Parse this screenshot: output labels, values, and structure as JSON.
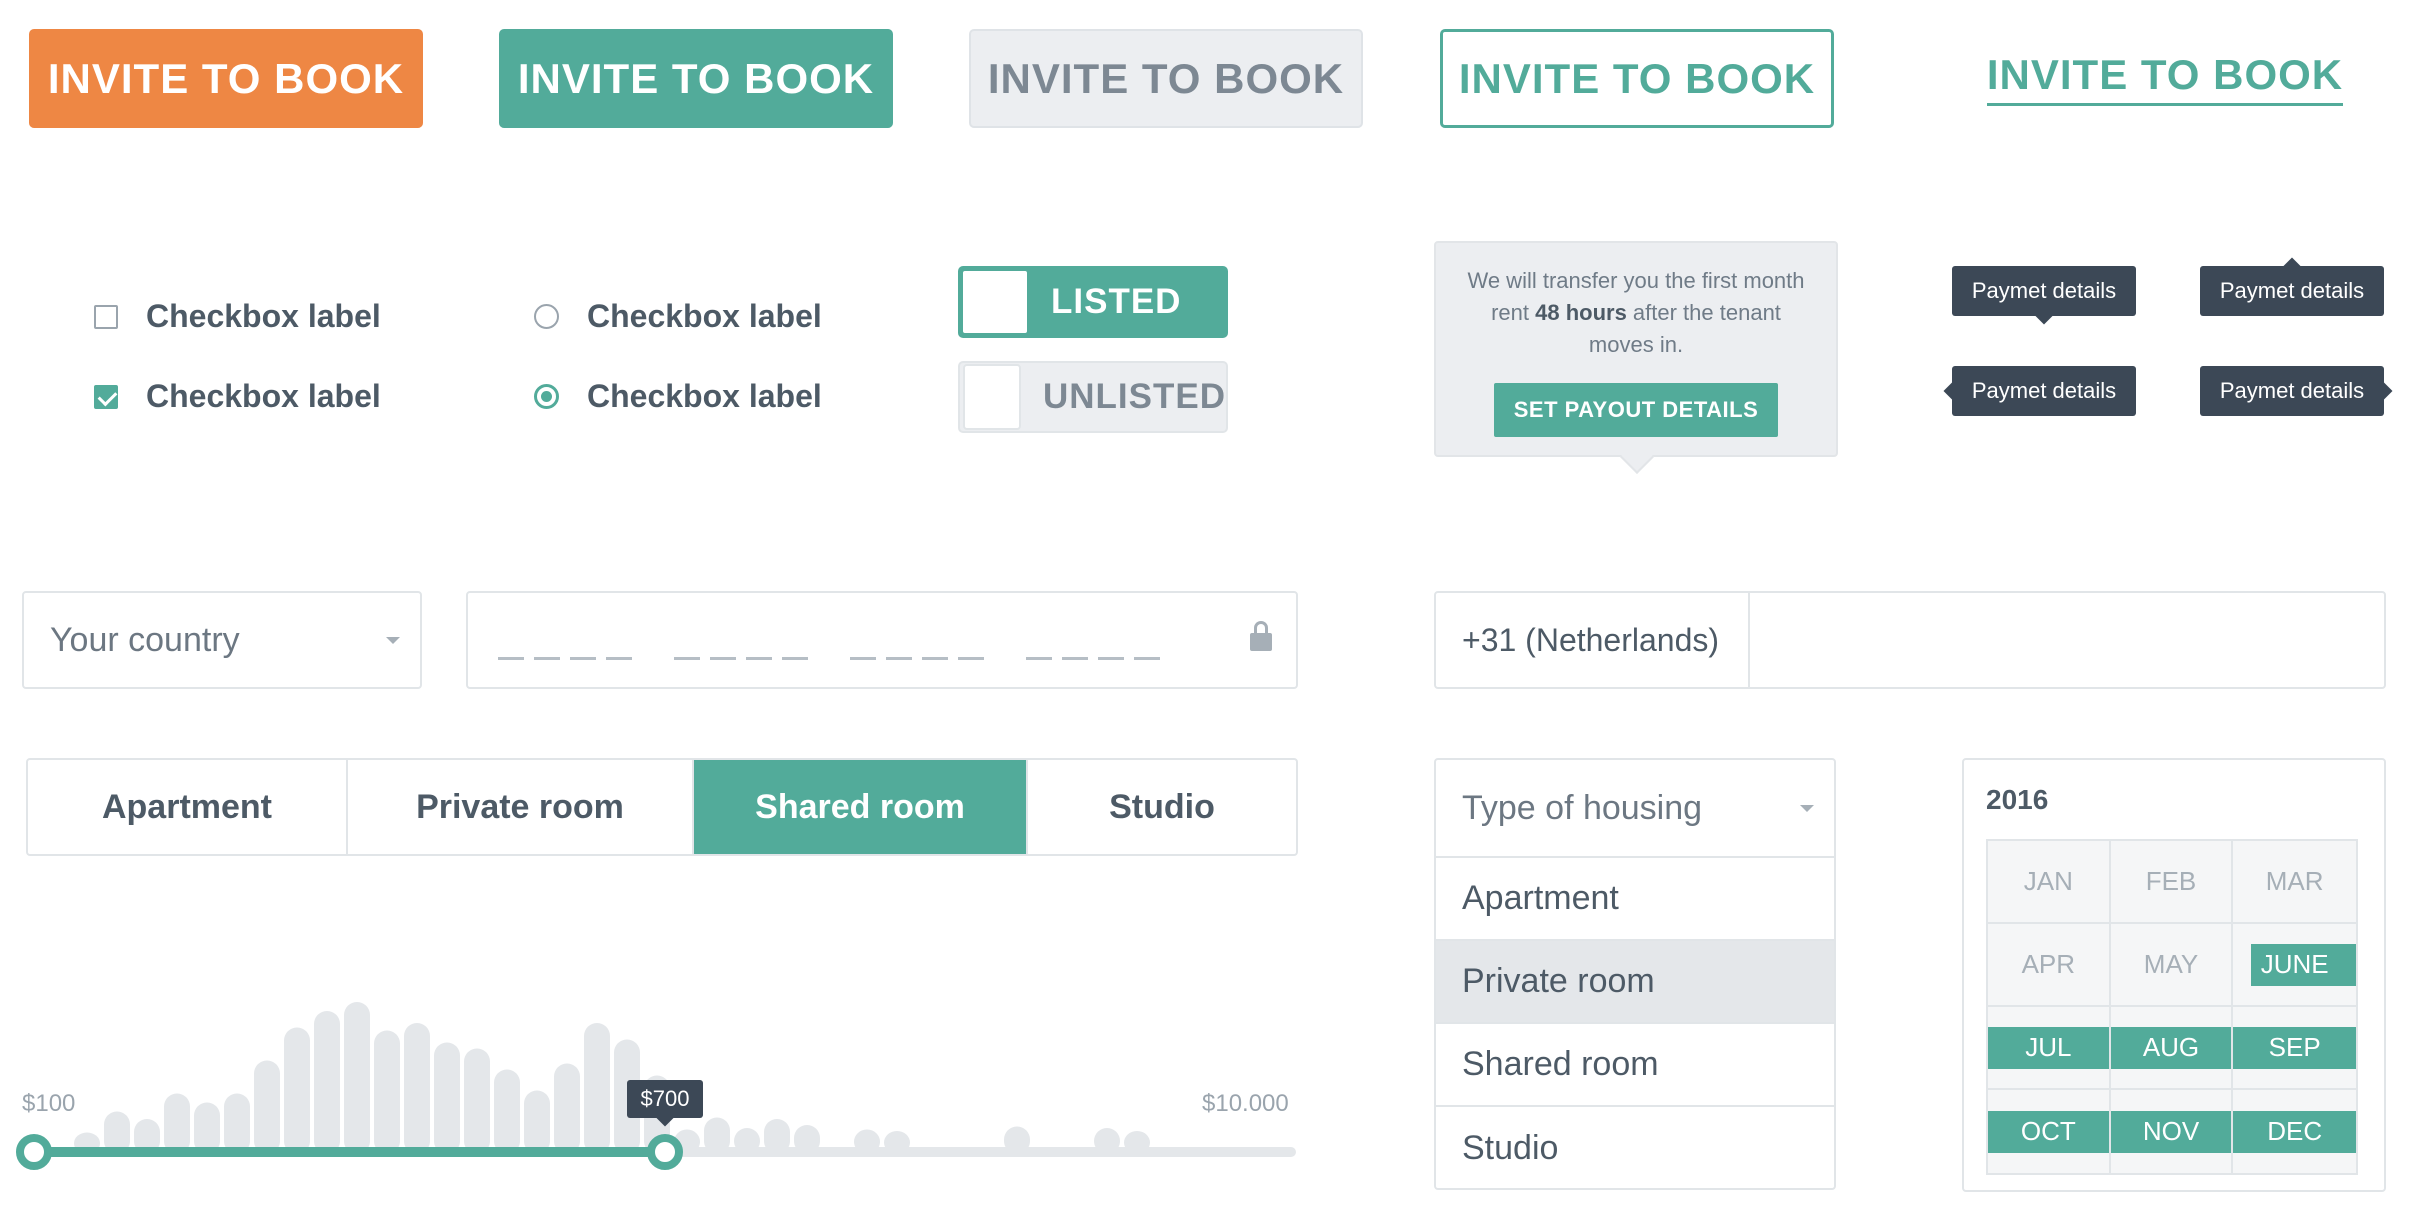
{
  "buttons": {
    "orange": "INVITE TO BOOK",
    "teal": "INVITE TO BOOK",
    "grey": "INVITE TO BOOK",
    "outline": "INVITE TO BOOK",
    "link": "INVITE TO BOOK"
  },
  "checkboxes": [
    {
      "label": "Checkbox label",
      "checked": false
    },
    {
      "label": "Checkbox label",
      "checked": true
    }
  ],
  "radios": [
    {
      "label": "Checkbox label",
      "checked": false
    },
    {
      "label": "Checkbox label",
      "checked": true
    }
  ],
  "toggles": {
    "listed": "LISTED",
    "unlisted": "UNLISTED"
  },
  "popover": {
    "text_before": "We will transfer you the first month rent ",
    "text_bold": "48 hours",
    "text_after": " after the tenant moves in.",
    "button": "SET PAYOUT DETAILS"
  },
  "tooltips": {
    "down": "Paymet details",
    "up": "Paymet details",
    "left": "Paymet details",
    "right": "Paymet details"
  },
  "country_select": {
    "placeholder": "Your country"
  },
  "phone": {
    "code": "+31 (Netherlands)",
    "value": ""
  },
  "segmented": {
    "options": [
      "Apartment",
      "Private room",
      "Shared room",
      "Studio"
    ],
    "selected": "Shared room"
  },
  "price_slider": {
    "min_label": "$100",
    "max_label": "$10.000",
    "selected_value_label": "$700",
    "selected_fraction": 0.5,
    "histogram": [
      0.13,
      0.27,
      0.22,
      0.39,
      0.33,
      0.39,
      0.61,
      0.83,
      0.94,
      1.0,
      0.81,
      0.86,
      0.73,
      0.69,
      0.55,
      0.41,
      0.59,
      0.86,
      0.75,
      0.51,
      0.15,
      0.23,
      0.16,
      0.22,
      0.18,
      0.0,
      0.15,
      0.14,
      0.0,
      0.0,
      0.0,
      0.17,
      0.0,
      0.0,
      0.16,
      0.14
    ]
  },
  "housing_dropdown": {
    "placeholder": "Type of housing",
    "options": [
      "Apartment",
      "Private room",
      "Shared room",
      "Studio"
    ],
    "hovered": "Private room"
  },
  "month_picker": {
    "year": "2016",
    "months": [
      "JAN",
      "FEB",
      "MAR",
      "APR",
      "MAY",
      "JUNE",
      "JUL",
      "AUG",
      "SEP",
      "OCT",
      "NOV",
      "DEC"
    ],
    "selected_range": [
      "JUNE",
      "DEC"
    ]
  },
  "colors": {
    "accent": "#52ab9a",
    "orange": "#ee8744",
    "dark": "#3c4856",
    "bar": "#e4e7ea"
  }
}
